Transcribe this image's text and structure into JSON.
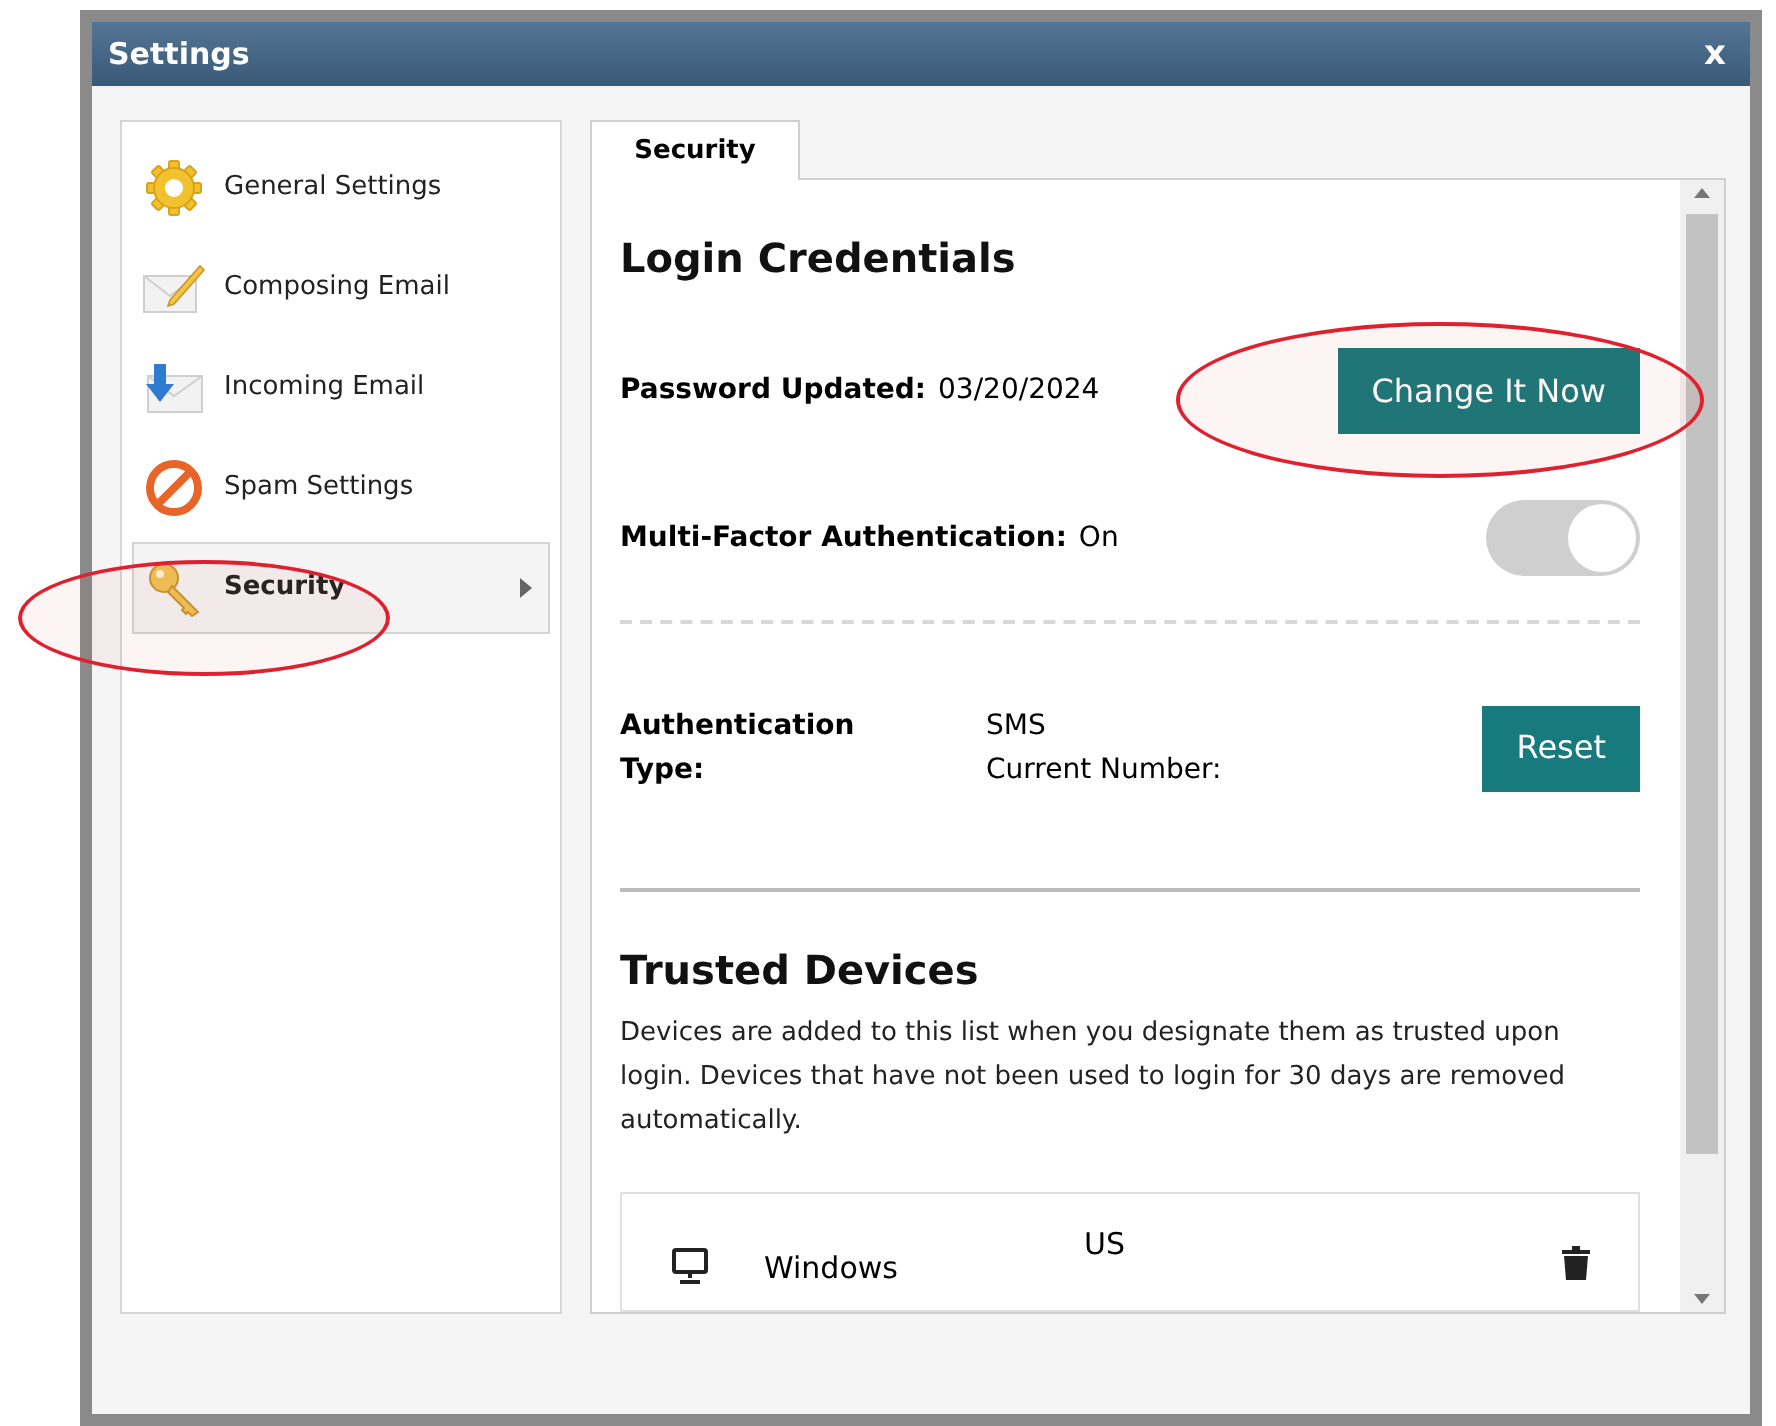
{
  "window": {
    "title": "Settings",
    "close": "x"
  },
  "sidebar": {
    "items": [
      {
        "label": "General Settings",
        "selected": false
      },
      {
        "label": "Composing Email",
        "selected": false
      },
      {
        "label": "Incoming Email",
        "selected": false
      },
      {
        "label": "Spam Settings",
        "selected": false
      },
      {
        "label": "Security",
        "selected": true
      }
    ]
  },
  "tabs": [
    {
      "label": "Security",
      "selected": true
    }
  ],
  "login_credentials": {
    "heading": "Login Credentials",
    "password_label": "Password Updated:",
    "password_value": "03/20/2024",
    "change_button": "Change It Now",
    "mfa_label": "Multi-Factor Authentication:",
    "mfa_value": "On",
    "mfa_on": true,
    "auth_type_label": "Authentication Type:",
    "auth_type_value": "SMS",
    "current_number_label": "Current Number:",
    "reset_button": "Reset"
  },
  "trusted_devices": {
    "heading": "Trusted Devices",
    "description": "Devices are added to this list when you designate them as trusted upon login. Devices that have not been used to login for 30 days are removed automatically.",
    "devices": [
      {
        "name": "Windows",
        "location": "US"
      }
    ]
  }
}
